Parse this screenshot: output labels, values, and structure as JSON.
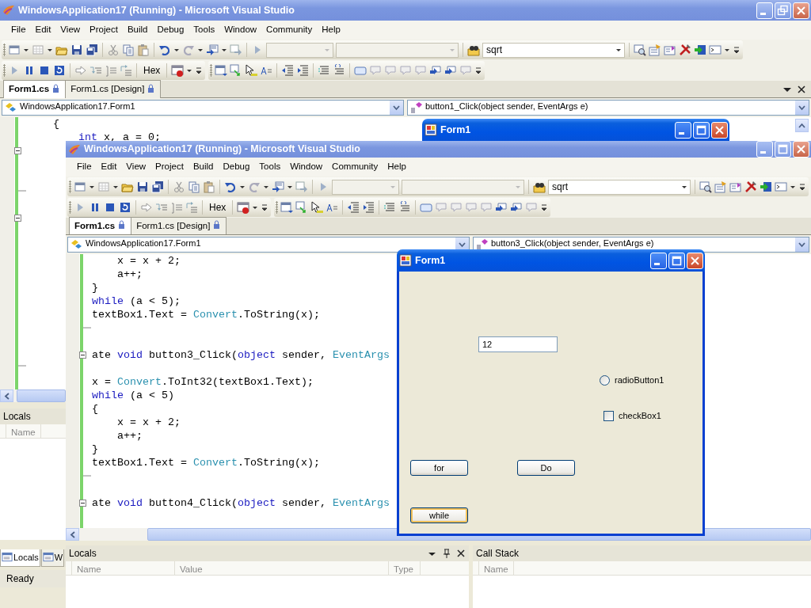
{
  "back_window": {
    "title": "WindowsApplication17 (Running) - Microsoft Visual Studio",
    "menu": [
      "File",
      "Edit",
      "View",
      "Project",
      "Build",
      "Debug",
      "Tools",
      "Window",
      "Community",
      "Help"
    ],
    "search_value": "sqrt",
    "hex_button": "Hex",
    "tabs": [
      {
        "label": "Form1.cs",
        "selected": true
      },
      {
        "label": "Form1.cs [Design]",
        "selected": false
      }
    ],
    "class_dropdown": "WindowsApplication17.Form1",
    "member_dropdown": "button1_Click(object sender, EventArgs e)",
    "code_lines": [
      {
        "kind": "code",
        "tokens": [
          {
            "text": "    {",
            "kind": "plain"
          }
        ]
      },
      {
        "kind": "code",
        "tokens": [
          {
            "text": "        int",
            "kind": "keyword"
          },
          {
            "text": " x, a = 0;",
            "kind": "plain"
          }
        ]
      },
      {
        "kind": "block_start"
      },
      {
        "kind": "blank"
      },
      {
        "kind": "blank"
      },
      {
        "kind": "block_end"
      },
      {
        "kind": "blank"
      },
      {
        "kind": "block_start"
      },
      {
        "kind": "blank"
      },
      {
        "kind": "blank"
      },
      {
        "kind": "blank"
      },
      {
        "kind": "blank"
      },
      {
        "kind": "blank"
      },
      {
        "kind": "blank"
      },
      {
        "kind": "blank"
      },
      {
        "kind": "blank"
      },
      {
        "kind": "blank"
      },
      {
        "kind": "blank"
      },
      {
        "kind": "block_end"
      }
    ],
    "locals_pane": {
      "title": "Locals",
      "columns": [
        "Name"
      ]
    },
    "bottom_tabs": [
      {
        "label": "Locals",
        "selected": true
      },
      {
        "label": "W",
        "selected": false
      }
    ],
    "status": "Ready"
  },
  "back_form": {
    "title": "Form1"
  },
  "front_window": {
    "title": "WindowsApplication17 (Running) - Microsoft Visual Studio",
    "menu": [
      "File",
      "Edit",
      "View",
      "Project",
      "Build",
      "Debug",
      "Tools",
      "Window",
      "Community",
      "Help"
    ],
    "search_value": "sqrt",
    "hex_button": "Hex",
    "tabs": [
      {
        "label": "Form1.cs",
        "selected": true
      },
      {
        "label": "Form1.cs [Design]",
        "selected": false
      }
    ],
    "class_dropdown": "WindowsApplication17.Form1",
    "member_dropdown": "button3_Click(object sender, EventArgs e)",
    "code_lines": [
      {
        "kind": "code",
        "tokens": [
          {
            "text": "    x = x + 2;",
            "kind": "plain"
          }
        ]
      },
      {
        "kind": "code",
        "tokens": [
          {
            "text": "    a++;",
            "kind": "plain"
          }
        ]
      },
      {
        "kind": "code",
        "tokens": [
          {
            "text": "}",
            "kind": "plain"
          }
        ]
      },
      {
        "kind": "code",
        "tokens": [
          {
            "text": "while",
            "kind": "keyword"
          },
          {
            "text": " (a < 5);",
            "kind": "plain"
          }
        ]
      },
      {
        "kind": "code",
        "tokens": [
          {
            "text": "textBox1.Text = ",
            "kind": "plain"
          },
          {
            "text": "Convert",
            "kind": "type"
          },
          {
            "text": ".ToString(x);",
            "kind": "plain"
          }
        ]
      },
      {
        "kind": "block_end"
      },
      {
        "kind": "blank"
      },
      {
        "kind": "block_start",
        "tokens": [
          {
            "text": "ate ",
            "kind": "plain"
          },
          {
            "text": "void",
            "kind": "keyword"
          },
          {
            "text": " button3_Click(",
            "kind": "plain"
          },
          {
            "text": "object",
            "kind": "keyword"
          },
          {
            "text": " sender, ",
            "kind": "plain"
          },
          {
            "text": "EventArgs",
            "kind": "type"
          }
        ]
      },
      {
        "kind": "blank"
      },
      {
        "kind": "code",
        "tokens": [
          {
            "text": "x = ",
            "kind": "plain"
          },
          {
            "text": "Convert",
            "kind": "type"
          },
          {
            "text": ".ToInt32(textBox1.Text);",
            "kind": "plain"
          }
        ]
      },
      {
        "kind": "code",
        "tokens": [
          {
            "text": "while",
            "kind": "keyword"
          },
          {
            "text": " (a < 5)",
            "kind": "plain"
          }
        ]
      },
      {
        "kind": "code",
        "tokens": [
          {
            "text": "{",
            "kind": "plain"
          }
        ]
      },
      {
        "kind": "code",
        "tokens": [
          {
            "text": "    x = x + 2;",
            "kind": "plain"
          }
        ]
      },
      {
        "kind": "code",
        "tokens": [
          {
            "text": "    a++;",
            "kind": "plain"
          }
        ]
      },
      {
        "kind": "code",
        "tokens": [
          {
            "text": "}",
            "kind": "plain"
          }
        ]
      },
      {
        "kind": "code",
        "tokens": [
          {
            "text": "textBox1.Text = ",
            "kind": "plain"
          },
          {
            "text": "Convert",
            "kind": "type"
          },
          {
            "text": ".ToString(x);",
            "kind": "plain"
          }
        ]
      },
      {
        "kind": "block_end"
      },
      {
        "kind": "blank"
      },
      {
        "kind": "block_start",
        "tokens": [
          {
            "text": "ate ",
            "kind": "plain"
          },
          {
            "text": "void",
            "kind": "keyword"
          },
          {
            "text": " button4_Click(",
            "kind": "plain"
          },
          {
            "text": "object",
            "kind": "keyword"
          },
          {
            "text": " sender, ",
            "kind": "plain"
          },
          {
            "text": "EventArgs",
            "kind": "type"
          }
        ]
      }
    ],
    "locals_pane": {
      "title": "Locals",
      "columns": [
        "Name",
        "Value",
        "Type"
      ]
    },
    "call_stack_pane": {
      "title": "Call Stack",
      "columns": [
        "Name"
      ]
    }
  },
  "form": {
    "title": "Form1",
    "textbox_value": "12",
    "radio": {
      "label": "radioButton1",
      "checked": false
    },
    "checkbox": {
      "label": "checkBox1",
      "checked": false
    },
    "buttons": [
      {
        "label": "for",
        "focused": false
      },
      {
        "label": "Do",
        "focused": false
      },
      {
        "label": "while",
        "focused": true
      }
    ]
  }
}
